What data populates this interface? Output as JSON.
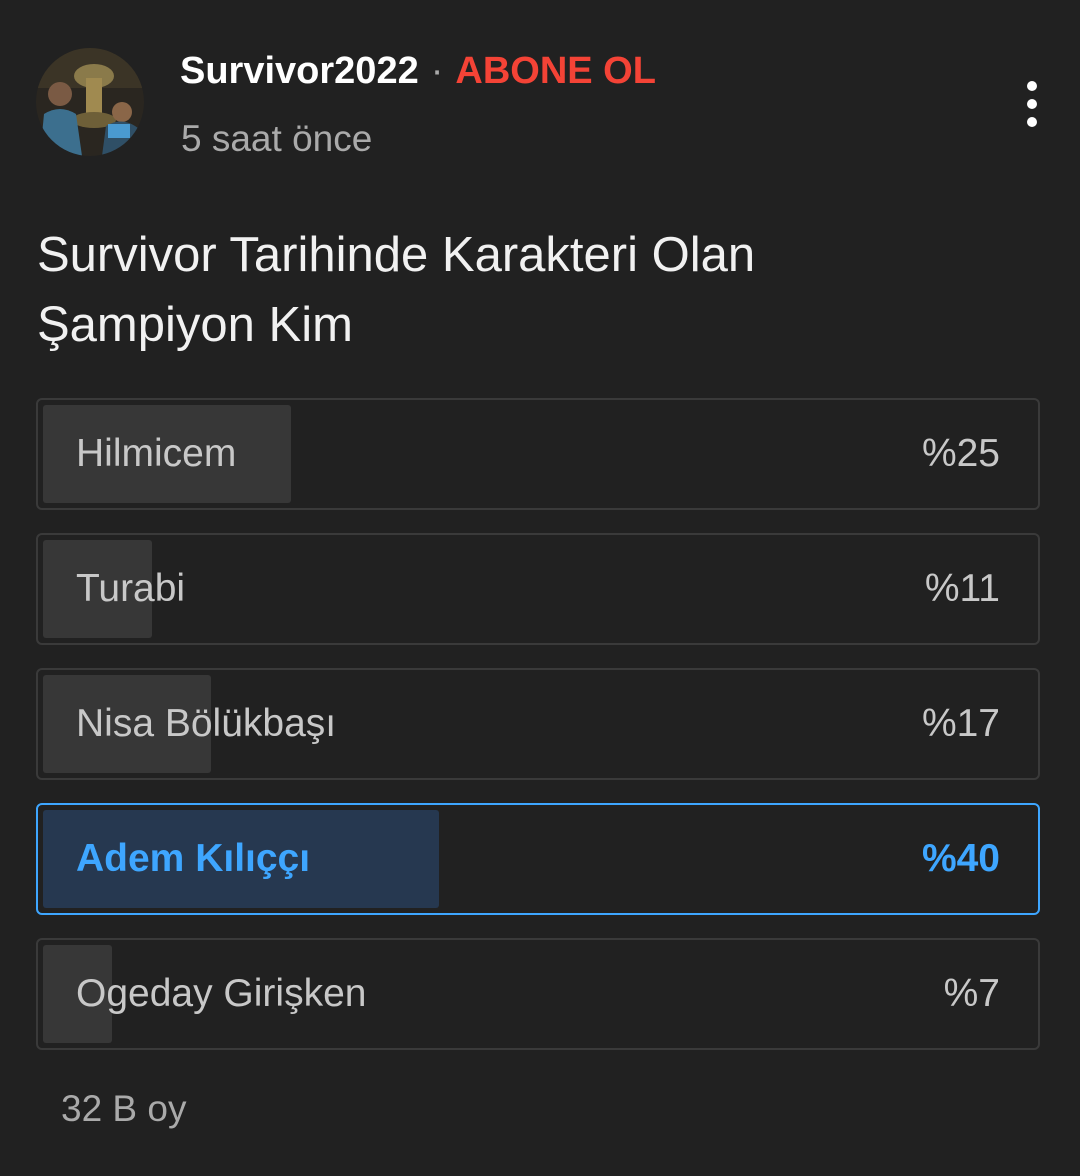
{
  "post": {
    "channel_name": "Survivor2022",
    "separator": "·",
    "subscribe_label": "ABONE OL",
    "time": "5 saat önce",
    "question": "Survivor Tarihinde Karakteri Olan Şampiyon Kim",
    "votes": "32 B oy"
  },
  "poll": {
    "options": [
      {
        "label": "Hilmicem",
        "percent_text": "%25",
        "percent": 25,
        "selected": false
      },
      {
        "label": "Turabi",
        "percent_text": "%11",
        "percent": 11,
        "selected": false
      },
      {
        "label": "Nisa Bölükbaşı",
        "percent_text": "%17",
        "percent": 17,
        "selected": false
      },
      {
        "label": "Adem Kılıççı",
        "percent_text": "%40",
        "percent": 40,
        "selected": true
      },
      {
        "label": "Ogeday Girişken",
        "percent_text": "%7",
        "percent": 7,
        "selected": false
      }
    ]
  },
  "icons": {
    "more": "more-vert-icon",
    "avatar": "channel-avatar"
  },
  "colors": {
    "background": "#212121",
    "subscribe": "#f44336",
    "selected_accent": "#3ea6ff",
    "selected_fill": "#263850",
    "bar_fill": "#373737"
  }
}
